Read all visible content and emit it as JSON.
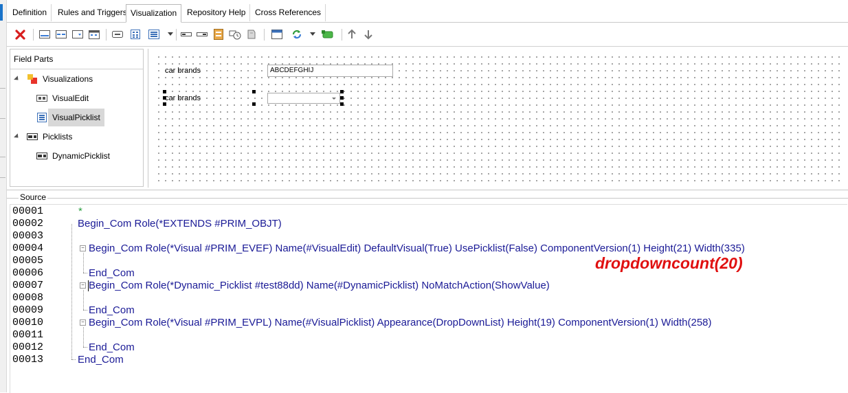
{
  "tabs": [
    {
      "label": "Definition",
      "active": false
    },
    {
      "label": "Rules and Triggers",
      "active": false
    },
    {
      "label": "Visualization",
      "active": true
    },
    {
      "label": "Repository Help",
      "active": false
    },
    {
      "label": "Cross References",
      "active": false
    }
  ],
  "field_parts": {
    "header": "Field Parts",
    "tree": {
      "visualizations": "Visualizations",
      "visual_edit": "VisualEdit",
      "visual_picklist": "VisualPicklist",
      "picklists": "Picklists",
      "dynamic_picklist": "DynamicPicklist"
    }
  },
  "canvas": {
    "edit_label": "car brands",
    "edit_value": "ABCDEFGHIJ",
    "picklist_label": "car brands",
    "picklist_value": ""
  },
  "source": {
    "title": "Source",
    "lines": [
      {
        "num": "00001",
        "text": "*"
      },
      {
        "num": "00002",
        "text": "Begin_Com Role(*EXTENDS #PRIM_OBJT)"
      },
      {
        "num": "00003",
        "text": ""
      },
      {
        "num": "00004",
        "text": "Begin_Com Role(*Visual #PRIM_EVEF) Name(#VisualEdit) DefaultVisual(True) UsePicklist(False) ComponentVersion(1) Height(21) Width(335)"
      },
      {
        "num": "00005",
        "text": ""
      },
      {
        "num": "00006",
        "text": "End_Com"
      },
      {
        "num": "00007",
        "text": "Begin_Com Role(*Dynamic_Picklist #test88dd) Name(#DynamicPicklist) NoMatchAction(ShowValue)"
      },
      {
        "num": "00008",
        "text": ""
      },
      {
        "num": "00009",
        "text": "End_Com"
      },
      {
        "num": "00010",
        "text": "Begin_Com Role(*Visual #PRIM_EVPL) Name(#VisualPicklist) Appearance(DropDownList) Height(19) ComponentVersion(1) Width(258)"
      },
      {
        "num": "00011",
        "text": ""
      },
      {
        "num": "00012",
        "text": "End_Com"
      },
      {
        "num": "00013",
        "text": "End_Com"
      }
    ]
  },
  "annotation": "dropdowncount(20)",
  "colors": {
    "code": "#1a1a96",
    "annotation": "#e01010",
    "comment": "#2ea043"
  }
}
